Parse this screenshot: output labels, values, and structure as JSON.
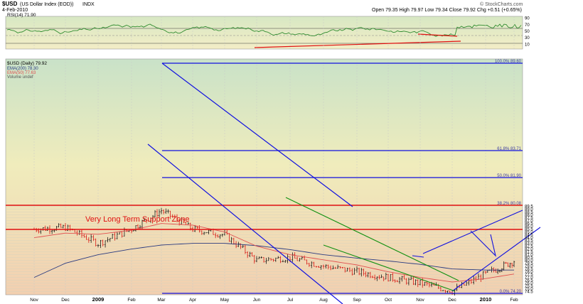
{
  "header": {
    "symbol": "$USD",
    "name": "(US Dollar Index (EOD))",
    "exchange": "INDX",
    "date": "4-Feb-2010",
    "ohlc": "Open 79.35  High 79.97  Low 79.34  Close 79.92  Chg +0.51 (+0.65%)",
    "credit": "© StockCharts.com"
  },
  "rsi_panel": {
    "legend": "RSI(14) 71.90",
    "ticks": [
      "90",
      "70",
      "50",
      "30",
      "10"
    ]
  },
  "price_panel": {
    "legend_title": "$USD (Daily) 79.92",
    "legend_ema200": "EMA(200) 78.30",
    "legend_ema50": "EMA(50) 77.63",
    "legend_volume": "Volume undef",
    "annotation": "Very Long Term Support Zone",
    "level_labels": [
      "100.0% 89.60",
      "61.8% 83.71",
      "50.0% 81.90",
      "38.2% 80.08",
      "0.0% 74.20"
    ],
    "y_ticks": [
      "89.5",
      "89.0",
      "88.5",
      "88.0",
      "87.5",
      "87.0",
      "86.5",
      "86.0",
      "85.5",
      "85.0",
      "84.5",
      "84.0",
      "83.5",
      "83.0",
      "82.5",
      "82.0",
      "81.5",
      "81.0",
      "80.5",
      "80.0",
      "79.5",
      "79.0",
      "78.5",
      "78.0",
      "77.5",
      "77.0",
      "76.5",
      "76.0",
      "75.5",
      "75.0",
      "74.5"
    ]
  },
  "x_axis": [
    "Nov",
    "Dec",
    "2009",
    "Feb",
    "Mar",
    "Apr",
    "May",
    "Jun",
    "Jul",
    "Aug",
    "Sep",
    "Oct",
    "Nov",
    "Dec",
    "2010",
    "Feb"
  ],
  "colors": {
    "up": "#000000",
    "down": "#d40000",
    "ema200": "#2a3a80",
    "ema50": "#e05050",
    "trend": "#1010e0",
    "support": "#e01010",
    "green": "#109010",
    "rsi": "#2e8b2e"
  },
  "chart_data": {
    "type": "line",
    "title": "$USD (US Dollar Index (EOD))",
    "xlabel": "",
    "ylabel": "",
    "ylim": [
      74.2,
      89.6
    ],
    "x": [
      "Nov",
      "Dec",
      "2009",
      "Feb",
      "Mar",
      "Apr",
      "May",
      "Jun",
      "Jul",
      "Aug",
      "Sep",
      "Oct",
      "Nov",
      "Dec",
      "2010",
      "Feb"
    ],
    "series": [
      {
        "name": "$USD (Daily)",
        "values": [
          85.5,
          85.8,
          83.0,
          85.5,
          88.8,
          85.5,
          84.5,
          80.0,
          80.5,
          79.0,
          78.0,
          77.0,
          76.0,
          74.6,
          77.6,
          79.9
        ]
      },
      {
        "name": "EMA(200)",
        "values": [
          77.0,
          79.5,
          81.0,
          82.0,
          82.7,
          83.0,
          83.0,
          82.6,
          81.9,
          81.0,
          80.4,
          79.9,
          79.3,
          78.5,
          78.3,
          78.3
        ]
      },
      {
        "name": "EMA(50)",
        "values": [
          84.0,
          84.8,
          84.6,
          85.3,
          86.5,
          86.2,
          85.0,
          82.5,
          81.0,
          80.1,
          79.2,
          78.0,
          77.0,
          76.2,
          76.8,
          77.6
        ]
      }
    ],
    "fib_levels": [
      89.6,
      83.71,
      81.9,
      80.08,
      74.2
    ]
  }
}
